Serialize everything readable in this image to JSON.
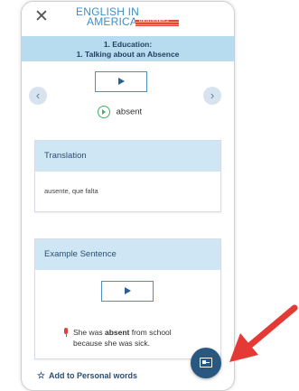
{
  "app": {
    "logo_line1": "ENGLISH IN",
    "logo_line2": "AMERICA",
    "logo_tag": "BEGINNERS"
  },
  "header": {
    "unit": "1. Education:",
    "lesson": "1. Talking about an Absence"
  },
  "close_label": "✕",
  "nav": {
    "prev": "‹",
    "next": "›"
  },
  "word": "absent",
  "translation_card": {
    "title": "Translation",
    "text": "ausente, que falta"
  },
  "example_card": {
    "title": "Example Sentence",
    "sentence_before": "She was ",
    "sentence_bold": "absent",
    "sentence_after": " from school",
    "sentence_line2": "because she was sick."
  },
  "add_personal_words": "Add to Personal words",
  "colors": {
    "header_band": "#b8dcef",
    "card_header": "#cfe7f5",
    "fab": "#28577f",
    "annotation_arrow": "#e53935"
  },
  "icons": {
    "close": "close-icon",
    "play": "play-icon",
    "audio": "audio-play-icon",
    "mic": "microphone-icon",
    "fab": "flashcard-icon",
    "star": "star-icon"
  }
}
